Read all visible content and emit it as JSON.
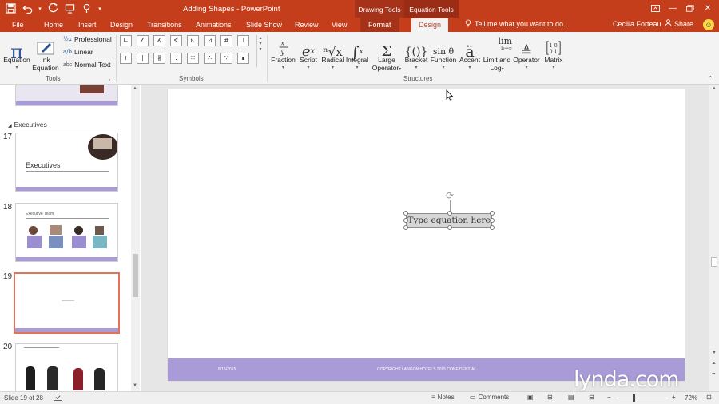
{
  "app": {
    "window_title": "Adding Shapes - PowerPoint",
    "context_groups": [
      "Drawing Tools",
      "Equation Tools"
    ],
    "user": "Cecilia Forteau",
    "share_label": "Share",
    "tell_me_placeholder": "Tell me what you want to do..."
  },
  "tabs": [
    {
      "label": "File"
    },
    {
      "label": "Home"
    },
    {
      "label": "Insert"
    },
    {
      "label": "Design"
    },
    {
      "label": "Transitions"
    },
    {
      "label": "Animations"
    },
    {
      "label": "Slide Show"
    },
    {
      "label": "Review"
    },
    {
      "label": "View"
    },
    {
      "label": "Format"
    },
    {
      "label": "Design",
      "active": true
    }
  ],
  "ribbon": {
    "tools": {
      "label": "Tools",
      "equation": "Equation",
      "ink_equation_line1": "Ink",
      "ink_equation_line2": "Equation",
      "professional": "Professional",
      "linear": "Linear",
      "normal_text": "Normal Text",
      "normal_text_prefix": "abc"
    },
    "symbols": {
      "label": "Symbols",
      "row1": [
        "∟",
        "∠",
        "∡",
        "∢",
        "⊾",
        "⊿",
        "#",
        "⊥"
      ],
      "row2": [
        "≀",
        "∣",
        "∦",
        ":",
        "∷",
        "∴",
        "∵",
        "∎"
      ]
    },
    "structures": {
      "label": "Structures",
      "items": [
        {
          "label": "Fraction",
          "glyph": "x/y"
        },
        {
          "label": "Script",
          "glyph": "eˣ"
        },
        {
          "label": "Radical",
          "glyph": "ⁿ√x"
        },
        {
          "label": "Integral",
          "glyph": "∫"
        },
        {
          "label": "Large Operator",
          "line1": "Large",
          "line2": "Operator",
          "glyph": "Σ"
        },
        {
          "label": "Bracket",
          "glyph": "{()}"
        },
        {
          "label": "Function",
          "glyph": "sinθ"
        },
        {
          "label": "Accent",
          "glyph": "ä"
        },
        {
          "label": "Limit and Log",
          "line1": "Limit and",
          "line2": "Log",
          "glyph": "lim"
        },
        {
          "label": "Operator",
          "glyph": "≜"
        },
        {
          "label": "Matrix",
          "glyph": "[10 01]"
        }
      ]
    }
  },
  "thumbnails": {
    "section": "Executives",
    "slides": [
      {
        "num": "17",
        "title": "Executives"
      },
      {
        "num": "18",
        "title": "Executive Team"
      },
      {
        "num": "19",
        "title": ""
      },
      {
        "num": "20",
        "title": ""
      }
    ]
  },
  "slide": {
    "equation_placeholder": "Type equation here",
    "footer_date": "6/15/2015",
    "footer_text": "COPYRIGHT LANGON HOTELS 2015 CONFIDENTIAL"
  },
  "status": {
    "slide_info": "Slide 19 of 28",
    "notes": "Notes",
    "comments": "Comments",
    "zoom": "72%"
  },
  "watermark": "lynda.com",
  "colors": {
    "ribbon_accent": "#c43e1c",
    "slide_footer": "#a99bd8",
    "selected_thumb_border": "#e0735a"
  }
}
